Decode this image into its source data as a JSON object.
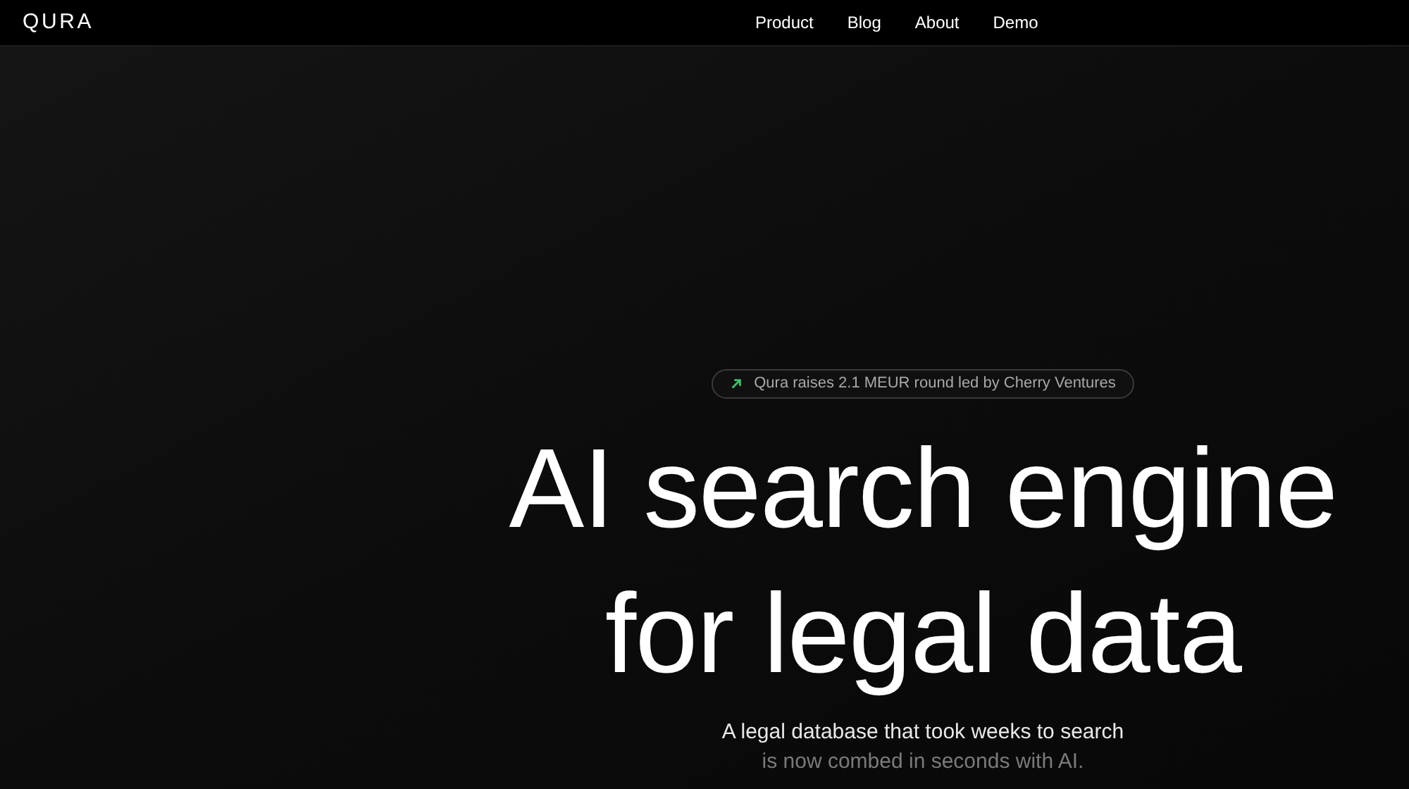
{
  "nav": {
    "logo": "QURA",
    "links": [
      "Product",
      "Blog",
      "About",
      "Demo"
    ]
  },
  "announcement": {
    "text": "Qura raises 2.1 MEUR round led by Cherry Ventures"
  },
  "headline": [
    "AI search engine",
    "for legal data"
  ],
  "subtitle": [
    "A legal database that took weeks to search",
    "is now combed in seconds with AI."
  ]
}
